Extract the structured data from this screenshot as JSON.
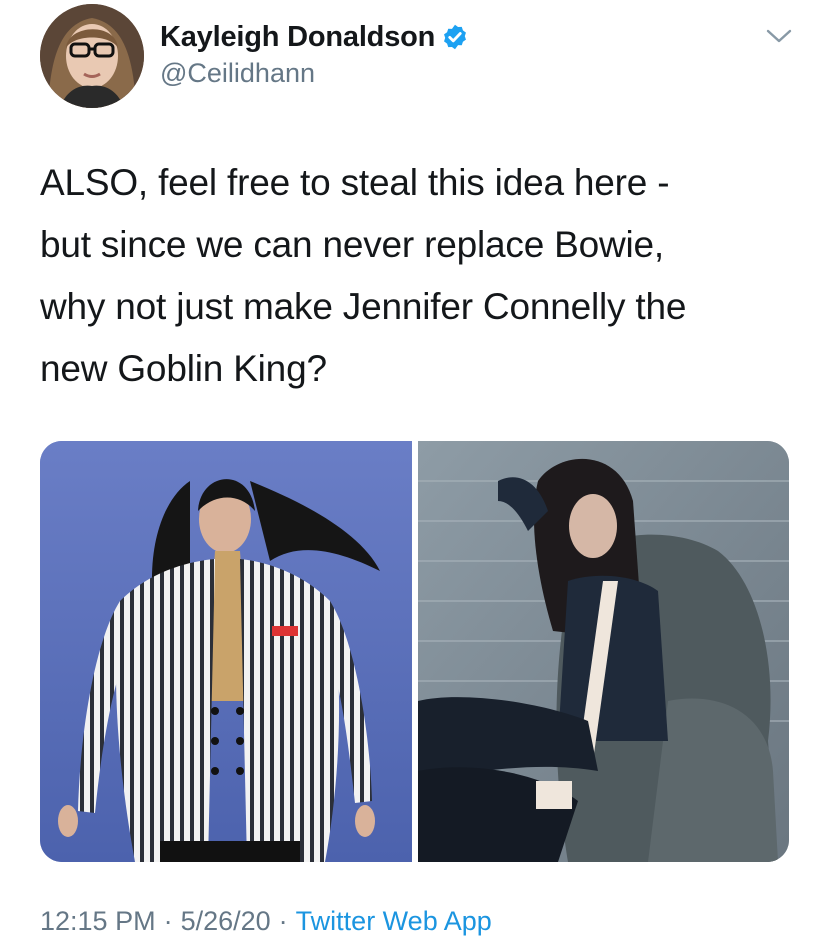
{
  "user": {
    "display_name": "Kayleigh Donaldson",
    "handle": "@Ceilidhann",
    "verified": true,
    "verified_icon": "verified-badge-icon"
  },
  "tweet": {
    "text": "ALSO, feel free to steal this idea here -\nbut since we can never replace Bowie,\nwhy not just make Jennifer Connelly the\nnew Goblin King?",
    "time": "12:15 PM",
    "date": "5/26/20",
    "separator": "·",
    "source": "Twitter Web App"
  },
  "media": {
    "count": 2
  },
  "colors": {
    "text": "#14171a",
    "secondary": "#657786",
    "link": "#1b95e0",
    "verified": "#1da1f2"
  }
}
